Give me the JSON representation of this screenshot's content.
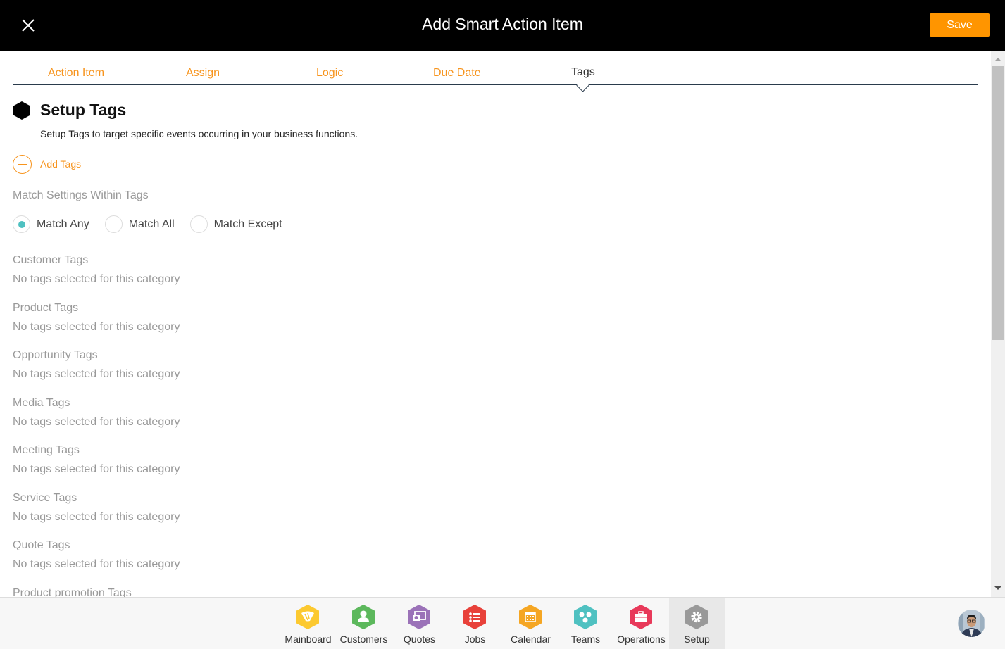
{
  "header": {
    "title": "Add Smart Action Item",
    "save_label": "Save",
    "close_icon": "close-icon"
  },
  "tabs": [
    {
      "label": "Action Item",
      "active": false
    },
    {
      "label": "Assign",
      "active": false
    },
    {
      "label": "Logic",
      "active": false
    },
    {
      "label": "Due Date",
      "active": false
    },
    {
      "label": "Tags",
      "active": true
    }
  ],
  "section": {
    "icon": "hexagon-icon",
    "title": "Setup Tags",
    "description": "Setup Tags to target specific events occurring in your business functions."
  },
  "add_tags": {
    "label": "Add Tags",
    "icon": "plus-circle-icon"
  },
  "match_settings": {
    "heading": "Match Settings Within Tags",
    "options": [
      {
        "label": "Match Any",
        "checked": true
      },
      {
        "label": "Match All",
        "checked": false
      },
      {
        "label": "Match Except",
        "checked": false
      }
    ]
  },
  "tag_categories": [
    {
      "name": "Customer Tags",
      "empty_text": "No tags selected for this category"
    },
    {
      "name": "Product Tags",
      "empty_text": "No tags selected for this category"
    },
    {
      "name": "Opportunity Tags",
      "empty_text": "No tags selected for this category"
    },
    {
      "name": "Media Tags",
      "empty_text": "No tags selected for this category"
    },
    {
      "name": "Meeting Tags",
      "empty_text": "No tags selected for this category"
    },
    {
      "name": "Service Tags",
      "empty_text": "No tags selected for this category"
    },
    {
      "name": "Quote Tags",
      "empty_text": "No tags selected for this category"
    },
    {
      "name": "Product promotion Tags",
      "empty_text": ""
    }
  ],
  "bottom_nav": [
    {
      "label": "Mainboard",
      "icon": "mainboard-icon",
      "color": "#fcc930",
      "active": false
    },
    {
      "label": "Customers",
      "icon": "customers-icon",
      "color": "#5cb85c",
      "active": false
    },
    {
      "label": "Quotes",
      "icon": "quotes-icon",
      "color": "#9b72b8",
      "active": false
    },
    {
      "label": "Jobs",
      "icon": "jobs-icon",
      "color": "#e8413a",
      "active": false
    },
    {
      "label": "Calendar",
      "icon": "calendar-icon",
      "color": "#f5a623",
      "active": false
    },
    {
      "label": "Teams",
      "icon": "teams-icon",
      "color": "#4fc1c1",
      "active": false
    },
    {
      "label": "Operations",
      "icon": "operations-icon",
      "color": "#e8395a",
      "active": false
    },
    {
      "label": "Setup",
      "icon": "gear-icon",
      "color": "#999999",
      "active": true
    }
  ],
  "colors": {
    "accent": "#ff9500",
    "tab_inactive": "#f7941d",
    "radio_checked": "#4fc1c1"
  }
}
